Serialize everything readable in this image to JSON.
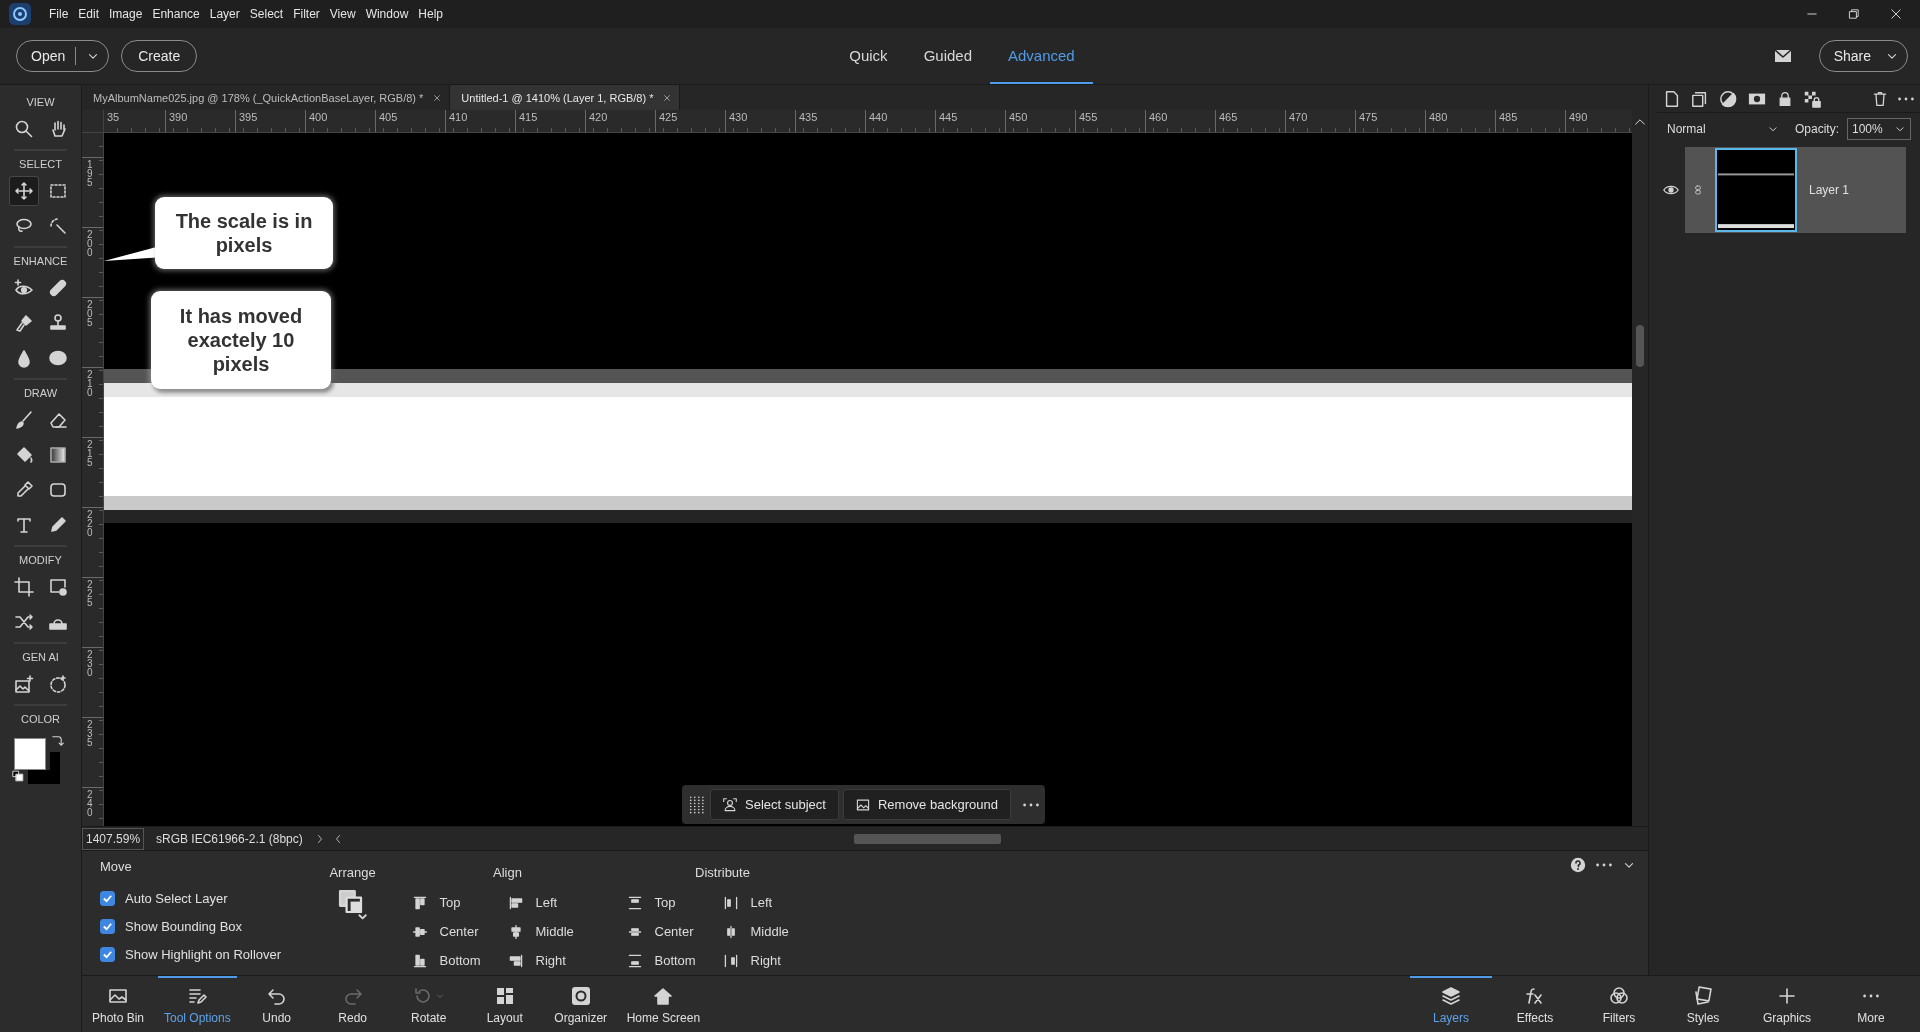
{
  "menu_bar": {
    "items": [
      "File",
      "Edit",
      "Image",
      "Enhance",
      "Layer",
      "Select",
      "Filter",
      "View",
      "Window",
      "Help"
    ]
  },
  "mode_bar": {
    "open": "Open",
    "create": "Create",
    "modes": [
      {
        "label": "Quick",
        "selected": false
      },
      {
        "label": "Guided",
        "selected": false
      },
      {
        "label": "Advanced",
        "selected": true
      }
    ],
    "share": "Share"
  },
  "toolbox": {
    "sections": [
      {
        "label": "VIEW",
        "tools": [
          {
            "selected": false
          },
          {
            "selected": false
          }
        ]
      },
      {
        "label": "SELECT",
        "tools": [
          {
            "selected": true
          },
          {
            "selected": false
          },
          {
            "selected": false
          },
          {
            "selected": false
          }
        ]
      },
      {
        "label": "ENHANCE",
        "tools": [
          {
            "selected": false
          },
          {
            "selected": false
          },
          {
            "selected": false
          },
          {
            "selected": false
          },
          {
            "selected": false
          },
          {
            "selected": false
          }
        ]
      },
      {
        "label": "DRAW",
        "tools": [
          {
            "selected": false
          },
          {
            "selected": false
          },
          {
            "selected": false
          },
          {
            "selected": false
          },
          {
            "selected": false
          },
          {
            "selected": false
          },
          {
            "selected": false
          },
          {
            "selected": false
          }
        ]
      },
      {
        "label": "MODIFY",
        "tools": [
          {
            "selected": false
          },
          {
            "selected": false
          },
          {
            "selected": false
          },
          {
            "selected": false
          }
        ]
      },
      {
        "label": "GEN AI",
        "tools": [
          {
            "selected": false
          },
          {
            "selected": false
          }
        ]
      }
    ],
    "color_label": "COLOR"
  },
  "document_tabs": [
    {
      "title": "MyAlbumName025.jpg @ 178% (_QuickActionBaseLayer, RGB/8) *",
      "selected": false
    },
    {
      "title": "Untitled-1 @ 1410% (Layer 1, RGB/8) *",
      "selected": true
    }
  ],
  "rulers": {
    "horizontal": [
      "35",
      "390",
      "395",
      "400",
      "405",
      "410",
      "415",
      "420",
      "425",
      "430",
      "435",
      "440",
      "445",
      "450",
      "455",
      "460",
      "465",
      "470",
      "475",
      "480",
      "485",
      "490"
    ],
    "vertical": [
      "195",
      "200",
      "205",
      "210",
      "215",
      "220",
      "225",
      "230",
      "235",
      "240"
    ]
  },
  "callouts": [
    {
      "text": "The scale is in pixels",
      "pointer": true
    },
    {
      "text": "It has moved exactely 10 pixels",
      "pointer": false
    }
  ],
  "quick_actions": {
    "buttons": [
      "Select subject",
      "Remove background"
    ]
  },
  "status_bar": {
    "zoom": "1407.59%",
    "profile": "sRGB IEC61966-2.1 (8bpc)"
  },
  "tool_options": {
    "title": "Move",
    "checkboxes": [
      {
        "label": "Auto Select Layer",
        "checked": true
      },
      {
        "label": "Show Bounding Box",
        "checked": true
      },
      {
        "label": "Show Highlight on Rollover",
        "checked": true
      }
    ],
    "arrange": {
      "label": "Arrange"
    },
    "align": {
      "label": "Align",
      "items": [
        "Top",
        "Center",
        "Bottom",
        "Left",
        "Middle",
        "Right"
      ]
    },
    "distribute": {
      "label": "Distribute",
      "items": [
        "Top",
        "Center",
        "Bottom",
        "Left",
        "Middle",
        "Right"
      ]
    }
  },
  "taskbar": {
    "left": [
      {
        "label": "Photo Bin",
        "selected": false,
        "disabled": false
      },
      {
        "label": "Tool Options",
        "selected": true,
        "disabled": false
      },
      {
        "label": "Undo",
        "selected": false,
        "disabled": false
      },
      {
        "label": "Redo",
        "selected": false,
        "disabled": true
      },
      {
        "label": "Rotate",
        "selected": false,
        "disabled": true
      },
      {
        "label": "Layout",
        "selected": false,
        "disabled": false
      },
      {
        "label": "Organizer",
        "selected": false,
        "disabled": false
      },
      {
        "label": "Home Screen",
        "selected": false,
        "disabled": false
      }
    ],
    "right": [
      {
        "label": "Layers",
        "selected": true
      },
      {
        "label": "Effects",
        "selected": false
      },
      {
        "label": "Filters",
        "selected": false
      },
      {
        "label": "Styles",
        "selected": false
      },
      {
        "label": "Graphics",
        "selected": false
      },
      {
        "label": "More",
        "selected": false
      }
    ]
  },
  "layers_panel": {
    "blend_mode": "Normal",
    "opacity_label": "Opacity:",
    "opacity": "100%",
    "layers": [
      {
        "name": "Layer 1",
        "selected": true,
        "visible": true
      }
    ]
  }
}
